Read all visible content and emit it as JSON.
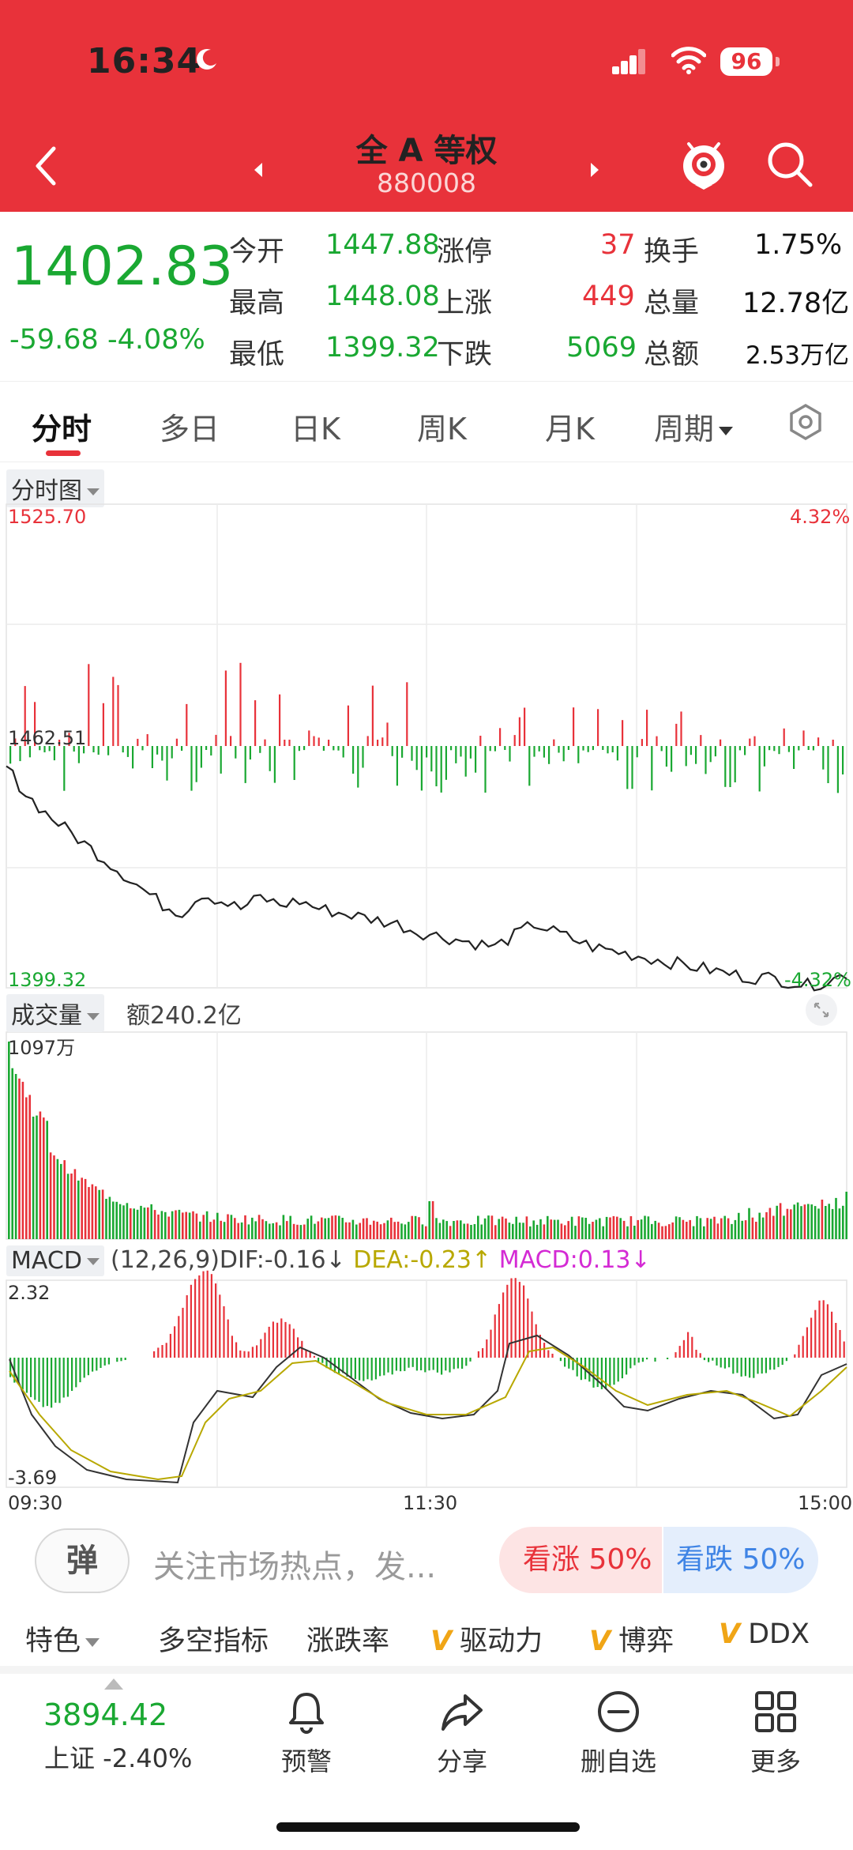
{
  "status_bar": {
    "time": "16:34",
    "battery": "96"
  },
  "header": {
    "title": "全 A 等权",
    "code": "880008"
  },
  "quote": {
    "price": "1402.83",
    "change": "-59.68",
    "change_pct": "-4.08%",
    "open_label": "今开",
    "open": "1447.88",
    "high_label": "最高",
    "high": "1448.08",
    "low_label": "最低",
    "low": "1399.32",
    "limit_up_label": "涨停",
    "limit_up": "37",
    "rise_label": "上涨",
    "rise": "449",
    "fall_label": "下跌",
    "fall": "5069",
    "turnover_label": "换手",
    "turnover": "1.75%",
    "volume_label": "总量",
    "volume": "12.78亿",
    "amount_label": "总额",
    "amount": "2.53万亿"
  },
  "tabs": [
    "分时",
    "多日",
    "日K",
    "周K",
    "月K",
    "周期"
  ],
  "intraday": {
    "selector": "分时图",
    "price_max": "1525.70",
    "price_mid": "1462.51",
    "price_min": "1399.32",
    "pct_max": "4.32%",
    "pct_min": "-4.32%"
  },
  "volume_panel": {
    "selector": "成交量",
    "amount_label": "额240.2亿",
    "max": "1097万"
  },
  "macd_panel": {
    "selector": "MACD",
    "params": "(12,26,9)",
    "dif": "DIF:-0.16↓",
    "dea": "DEA:-0.23↑",
    "macd": "MACD:0.13↓",
    "max": "2.32",
    "min": "-3.69"
  },
  "time_axis": [
    "09:30",
    "11:30",
    "15:00"
  ],
  "comment_bar": {
    "button": "弹",
    "placeholder": "关注市场热点，发...",
    "bull": "看涨 50%",
    "bear": "看跌 50%"
  },
  "indicators": [
    "特色",
    "多空指标",
    "涨跌率",
    "驱动力",
    "博弈",
    "DDX"
  ],
  "bottom_bar": {
    "index_value": "3894.42",
    "index_label": "上证 -2.40%",
    "alert": "预警",
    "share": "分享",
    "remove": "删自选",
    "more": "更多"
  },
  "colors": {
    "header_red": "#e8323a",
    "up_red": "#e8323a",
    "down_green": "#1aa832",
    "dea_yellow": "#b8a800",
    "macd_magenta": "#d42ad4"
  },
  "chart_data": {
    "type": "line",
    "x_axis": [
      "09:30",
      "11:30",
      "15:00"
    ],
    "price_range": [
      1399.32,
      1525.7
    ],
    "reference": 1462.51,
    "price_series": [
      1457,
      1450,
      1445,
      1441,
      1437,
      1433,
      1429,
      1425,
      1421,
      1419,
      1424,
      1422,
      1420,
      1423,
      1421,
      1422,
      1420,
      1419,
      1418,
      1417,
      1416,
      1414,
      1413,
      1412,
      1411,
      1410,
      1413,
      1416,
      1414,
      1412,
      1410,
      1409,
      1408,
      1407,
      1406,
      1405,
      1404,
      1403,
      1402,
      1402,
      1401,
      1400,
      1401,
      1403
    ],
    "volume_max": "1097万",
    "macd_range": [
      -3.69,
      2.32
    ]
  }
}
